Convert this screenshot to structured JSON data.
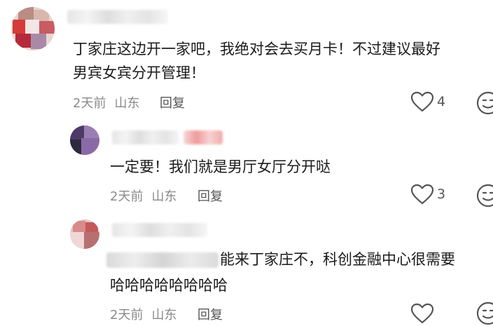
{
  "comments": [
    {
      "text_line1": "丁家庄这边开一家吧，我绝对会去买月卡！不过建议最好",
      "text_line2": "男宾女宾分开管理！",
      "time": "2天前",
      "location": "山东",
      "reply_label": "回复",
      "likes": "4"
    },
    {
      "text_line1": "一定要！我们就是男厅女厅分开哒",
      "time": "2天前",
      "location": "山东",
      "reply_label": "回复",
      "likes": "3"
    },
    {
      "text_line1_suffix": "能来丁家庄不，科创金融中心很需要",
      "text_line2": "哈哈哈哈哈哈哈哈",
      "time": "2天前",
      "location": "山东",
      "reply_label": "回复"
    }
  ],
  "icons": {
    "like": "heart-outline-icon",
    "emoji": "smiley-face-icon"
  },
  "colors": {
    "text": "#1a1a1a",
    "meta": "#8a8a8a",
    "icon": "#555555"
  }
}
